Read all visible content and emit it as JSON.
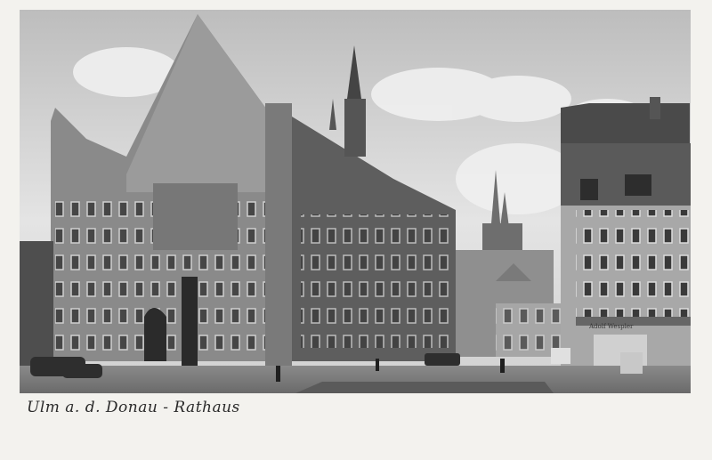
{
  "postcard": {
    "caption": "Ulm a. d. Donau - Rathaus",
    "shop_sign": "Adolf Wespler"
  },
  "colors": {
    "card": "#f3f2ee",
    "sky": "#d8d8d8",
    "ink": "#2a2a2a"
  }
}
